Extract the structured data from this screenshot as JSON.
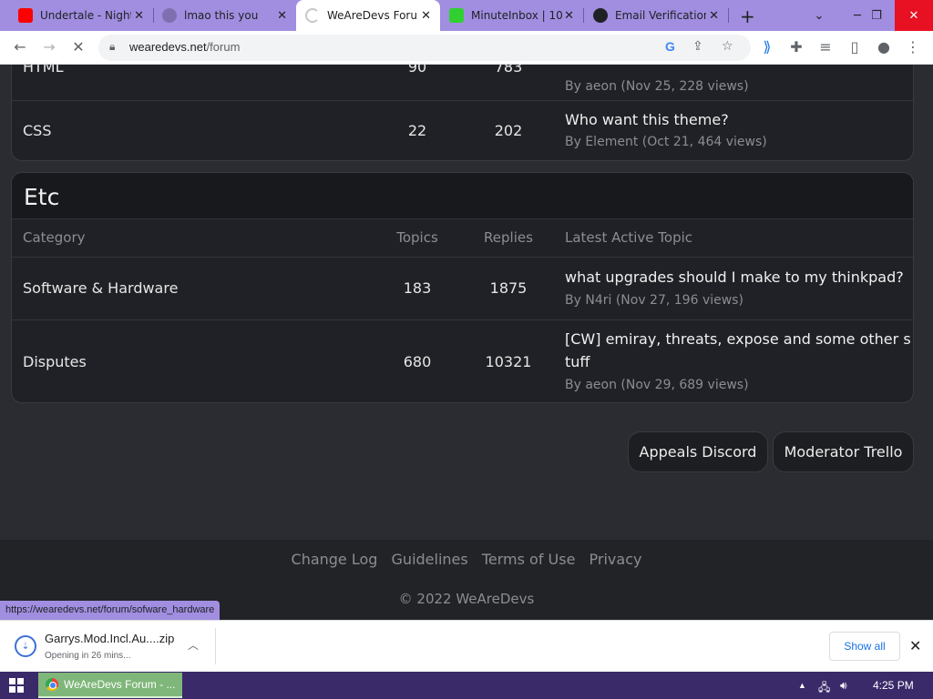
{
  "browser": {
    "tabs": [
      {
        "title": "Undertale - Nightmare",
        "favicon": "youtube-icon",
        "color": "#ff0000",
        "active": false
      },
      {
        "title": "lmao this you",
        "favicon": "globe-icon",
        "color": "#7f6fb0",
        "active": false
      },
      {
        "title": "WeAreDevs Forum",
        "favicon": "loading-icon",
        "color": "#c8c8c8",
        "active": true
      },
      {
        "title": "MinuteInbox | 10",
        "favicon": "minuteinbox-icon",
        "color": "#30d030",
        "active": false
      },
      {
        "title": "Email Verification",
        "favicon": "wrd-icon",
        "color": "#202124",
        "active": false
      }
    ],
    "url_host": "wearedevs.net",
    "url_path": "/forum",
    "status_url": "https://wearedevs.net/forum/sofware_hardware"
  },
  "forum": {
    "previous_section": {
      "rows": [
        {
          "category": "HTML",
          "topics": "90",
          "replies": "783",
          "topic": "",
          "byline": "By aeon (Nov 25, 228 views)"
        },
        {
          "category": "CSS",
          "topics": "22",
          "replies": "202",
          "topic": "Who want this theme?",
          "byline": "By Element (Oct 21, 464 views)"
        }
      ]
    },
    "etc_section": {
      "title": "Etc",
      "headers": {
        "category": "Category",
        "topics": "Topics",
        "replies": "Replies",
        "latest": "Latest Active Topic"
      },
      "rows": [
        {
          "category": "Software & Hardware",
          "topics": "183",
          "replies": "1875",
          "topic": "what upgrades should I make to my thinkpad?",
          "topic_line2": "",
          "byline": "By N4ri (Nov 27, 196 views)"
        },
        {
          "category": "Disputes",
          "topics": "680",
          "replies": "10321",
          "topic": "[CW] emiray, threats, expose and some other s",
          "topic_line2": "tuff",
          "byline": "By aeon (Nov 29, 689 views)"
        }
      ]
    },
    "buttons": {
      "appeals": "Appeals Discord",
      "trello": "Moderator Trello"
    },
    "footer": {
      "links": [
        "Change Log",
        "Guidelines",
        "Terms of Use",
        "Privacy"
      ],
      "copyright": "© 2022 WeAreDevs"
    }
  },
  "download": {
    "filename": "Garrys.Mod.Incl.Au....zip",
    "status": "Opening in 26 mins...",
    "show_all": "Show all"
  },
  "taskbar": {
    "app_label": "WeAreDevs Forum - ...",
    "time": "4:25 PM"
  }
}
